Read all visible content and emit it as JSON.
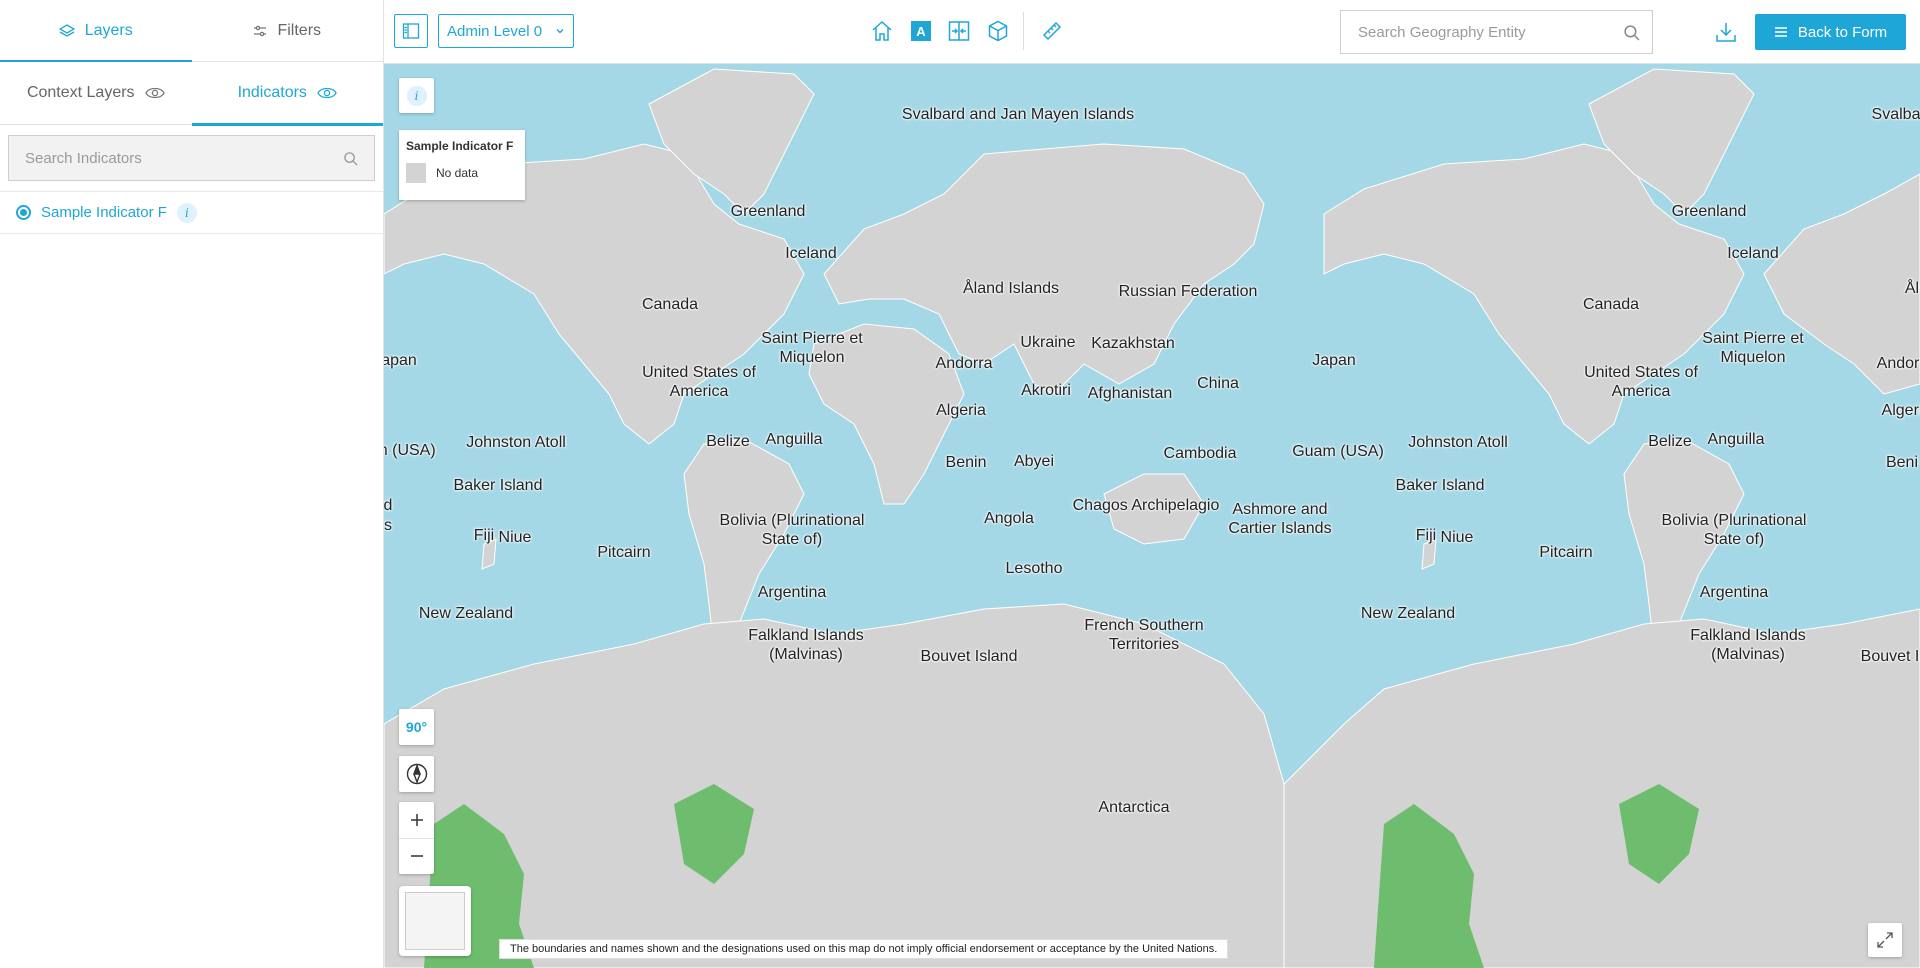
{
  "sidebar": {
    "tabs": [
      {
        "label": "Layers"
      },
      {
        "label": "Filters"
      }
    ],
    "subtabs": [
      {
        "label": "Context Layers"
      },
      {
        "label": "Indicators"
      }
    ],
    "search_placeholder": "Search Indicators",
    "indicators": [
      {
        "label": "Sample Indicator F",
        "selected": true
      }
    ]
  },
  "toolbar": {
    "admin_level": "Admin Level 0",
    "active_tool_letter": "A",
    "geo_search_placeholder": "Search Geography Entity",
    "back_label": "Back to Form"
  },
  "map": {
    "legend": {
      "title": "Sample Indicator F",
      "items": [
        {
          "label": "No data",
          "color": "#d3d3d3"
        }
      ]
    },
    "angle": "90°",
    "disclaimer": "The boundaries and names shown and the designations used on this map do not imply official endorsement or acceptance by the United Nations.",
    "labels": [
      "Svalbard and Jan Mayen Islands",
      "Greenland",
      "Iceland",
      "Åland Islands",
      "Russian Federation",
      "Canada",
      "Saint Pierre et Miquelon",
      "Ukraine",
      "Kazakhstan",
      "Andorra",
      "Japan",
      "United States of America",
      "Akrotiri",
      "Afghanistan",
      "China",
      "Algeria",
      "apan",
      "m (USA)",
      "Johnston Atoll",
      "Belize",
      "Anguilla",
      "Benin",
      "Abyei",
      "Cambodia",
      "Guam (USA)",
      "Baker Island",
      "Chagos Archipelagio",
      "Ashmore and Cartier Islands",
      "d",
      "s",
      "Fiji",
      "Niue",
      "Bolivia (Plurinational State of)",
      "Angola",
      "Pitcairn",
      "Lesotho",
      "Argentina",
      "New Zealand",
      "Falkland Islands (Malvinas)",
      "French Southern Territories",
      "Bouvet Island",
      "Antarctica",
      "Greenland",
      "Iceland",
      "Canada",
      "Saint Pierre et Miquelon",
      "United States of America",
      "Johnston Atoll",
      "Belize",
      "Anguilla",
      "Baker Island",
      "Fiji",
      "Niue",
      "Bolivia (Plurinational State of)",
      "Pitcairn",
      "Argentina",
      "New Zealand",
      "Falkland Islands (Malvinas)",
      "Svalba",
      "Ål",
      "Andor",
      "Algeri",
      "Beni",
      "Bouvet I"
    ],
    "colors": {
      "ocean": "#a5d8e6",
      "land": "#d3d3d3",
      "data_high": "#5cb85c",
      "accent": "#1ea7d6"
    }
  }
}
